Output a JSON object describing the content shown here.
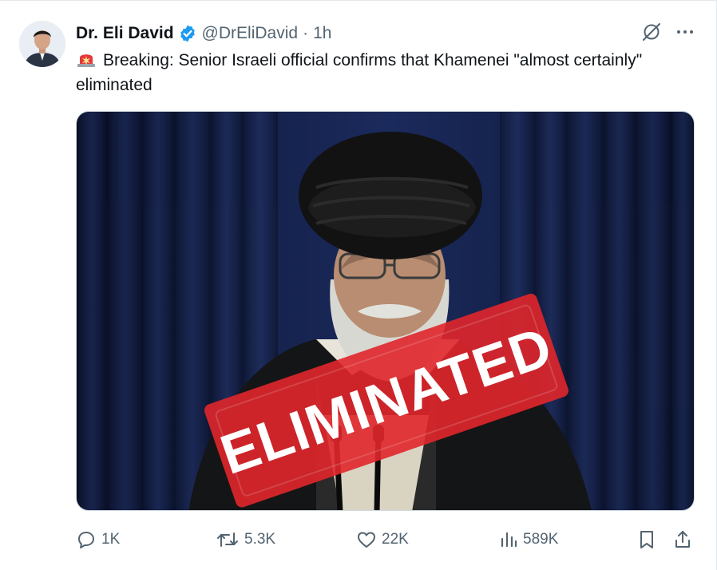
{
  "author": {
    "display_name": "Dr. Eli David",
    "handle": "@DrEliDavid",
    "separator": "·",
    "time": "1h",
    "verified": true
  },
  "tweet": {
    "text": "Breaking: Senior Israeli official confirms that Khamenei \"almost certainly\" eliminated",
    "leading_emoji": "police-car-light-icon"
  },
  "media": {
    "stamp_text": "ELIMINATED"
  },
  "actions": {
    "replies": "1K",
    "reposts": "5.3K",
    "likes": "22K",
    "views": "589K"
  },
  "colors": {
    "text": "#0f1419",
    "secondary": "#536471",
    "verified": "#1d9bf0",
    "stamp": "#e0262b",
    "curtain": "#15214a"
  }
}
